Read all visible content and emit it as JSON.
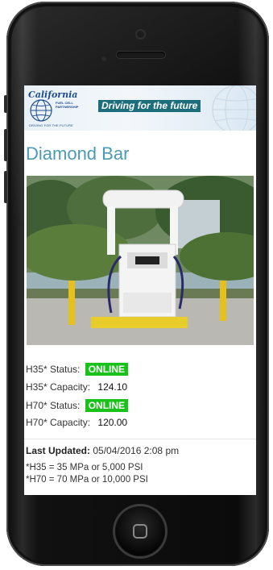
{
  "banner": {
    "logo_name": "California",
    "logo_subtitle": "FUEL CELL PARTNERSHIP",
    "logo_tagline": "DRIVING FOR THE FUTURE",
    "slogan": "Driving for the future"
  },
  "station": {
    "name": "Diamond Bar",
    "h35_status_label": "H35* Status:",
    "h35_status_value": "ONLINE",
    "h35_capacity_label": "H35* Capacity:",
    "h35_capacity_value": "124.10",
    "h70_status_label": "H70* Status:",
    "h70_status_value": "ONLINE",
    "h70_capacity_label": "H70* Capacity:",
    "h70_capacity_value": "120.00"
  },
  "footer": {
    "updated_label": "Last Updated:",
    "updated_value": "05/04/2016 2:08 pm",
    "note_h35": "*H35 = 35 MPa or 5,000 PSI",
    "note_h70": "*H70 = 70 MPa or 10,000 PSI"
  },
  "colors": {
    "accent": "#4a9bb3",
    "online": "#19c21a",
    "slogan_bg": "#1d6e7c"
  },
  "icons": {
    "home_button": "home-button-icon",
    "globe": "globe-icon"
  }
}
